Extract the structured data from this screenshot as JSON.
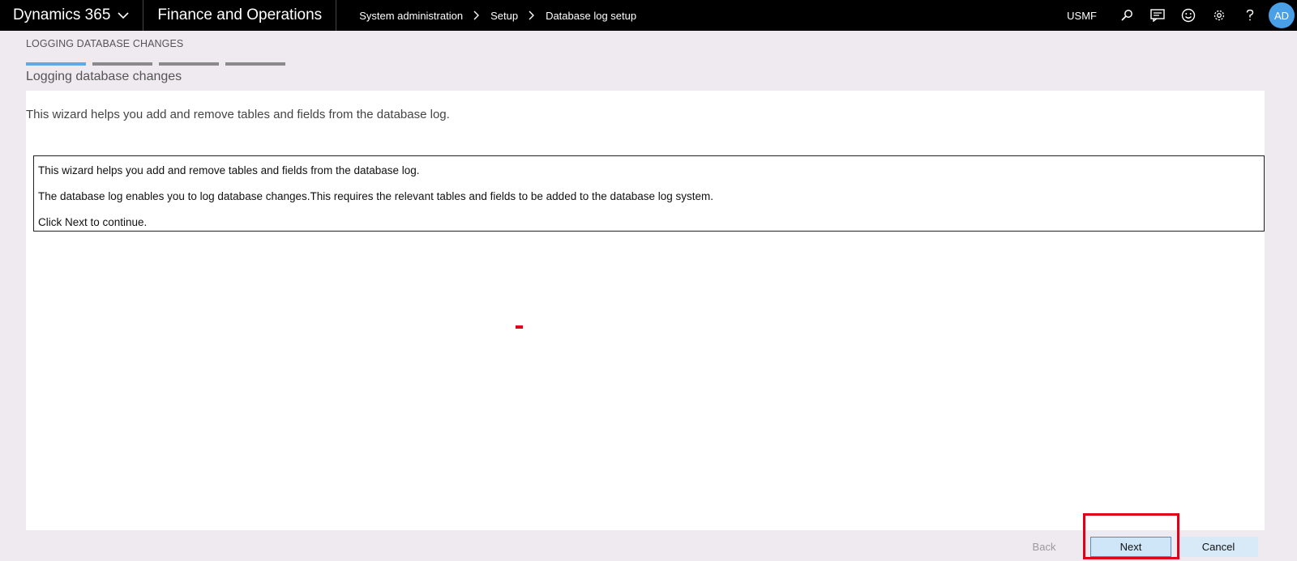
{
  "topbar": {
    "brand": "Dynamics 365",
    "module": "Finance and Operations",
    "breadcrumb": [
      "System administration",
      "Setup",
      "Database log setup"
    ],
    "company": "USMF",
    "avatar_initials": "AD",
    "icons": [
      "search-icon",
      "message-icon",
      "smiley-icon",
      "gear-icon",
      "help-icon"
    ]
  },
  "wizard": {
    "caption": "LOGGING DATABASE CHANGES",
    "steps_total": 4,
    "active_step": 1,
    "title": "Logging database changes",
    "intro": "This wizard helps you add and remove tables and fields from the database log.",
    "info_lines": [
      "This wizard helps you add and remove tables and fields from the database log.",
      "The database log enables you to log database changes.This requires the relevant tables and fields to be added to the database log system.",
      "Click Next to continue."
    ]
  },
  "buttons": {
    "back": "Back",
    "next": "Next",
    "cancel": "Cancel"
  },
  "colors": {
    "accent": "#5ea9e8",
    "highlight": "#e0001a"
  }
}
